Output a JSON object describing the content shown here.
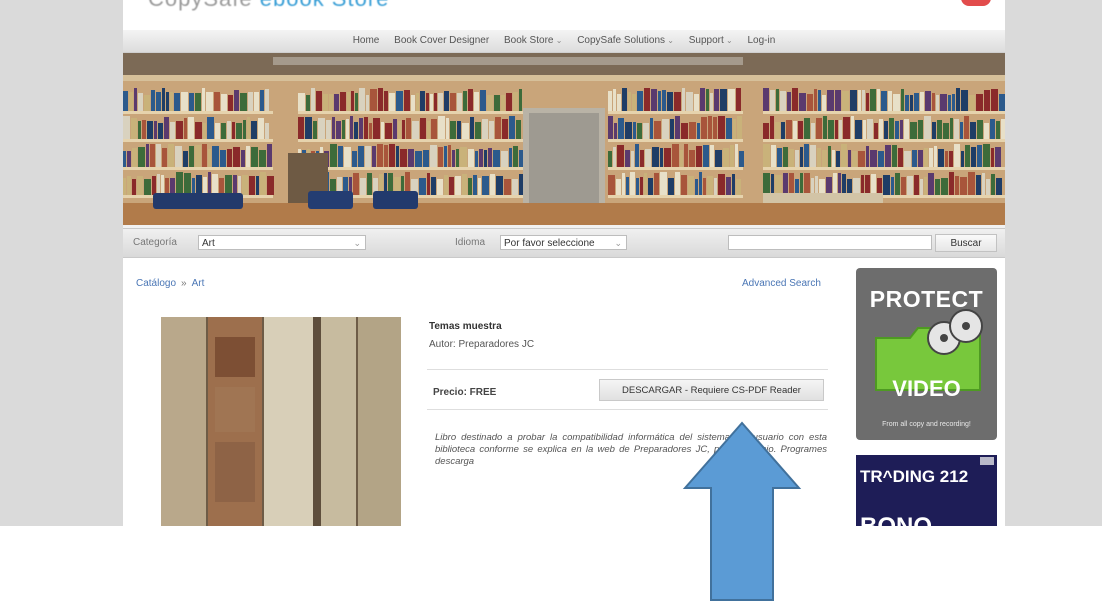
{
  "header": {
    "logo_text": "CopySafe",
    "logo_accent": "ebook Store",
    "accent_color": "#3a9fd6"
  },
  "nav": {
    "items": [
      {
        "label": "Home",
        "has_sub": false
      },
      {
        "label": "Book Cover Designer",
        "has_sub": false
      },
      {
        "label": "Book Store",
        "has_sub": true
      },
      {
        "label": "CopySafe Solutions",
        "has_sub": true
      },
      {
        "label": "Support",
        "has_sub": true
      },
      {
        "label": "Log-in",
        "has_sub": false
      }
    ]
  },
  "filters": {
    "category_label": "Categoría",
    "category_value": "Art",
    "language_label": "Idioma",
    "language_value": "Por favor seleccione",
    "search_value": "",
    "search_button": "Buscar"
  },
  "content": {
    "breadcrumb_root": "Catálogo",
    "breadcrumb_sep": "»",
    "breadcrumb_current": "Art",
    "advanced_search": "Advanced Search",
    "book_title": "Temas muestra",
    "book_author": "Autor: Preparadores JC",
    "price": "Precio: FREE",
    "download_button": "DESCARGAR - Requiere CS-PDF Reader",
    "description": "Libro destinado a probar la compatibilidad informática del sistema del usuario con esta biblioteca conforme se explica en la web de Preparadores JC, pestaña inicio. Programes descarga"
  },
  "ads": {
    "ad1_title": "PROTECT",
    "ad1_video": "VIDEO",
    "ad1_tagline": "From all copy and recording!",
    "ad2_title": "TR^DING 212",
    "ad2_sub": "BONO"
  },
  "icons": {
    "film-reel": "film-reel-icon",
    "folder": "folder-icon",
    "up-arrow": "up-arrow-annotation"
  },
  "colors": {
    "arrow_fill": "#5b9bd5",
    "arrow_stroke": "#41719c",
    "link": "#4a76b5",
    "ad_green": "#78c83c"
  }
}
